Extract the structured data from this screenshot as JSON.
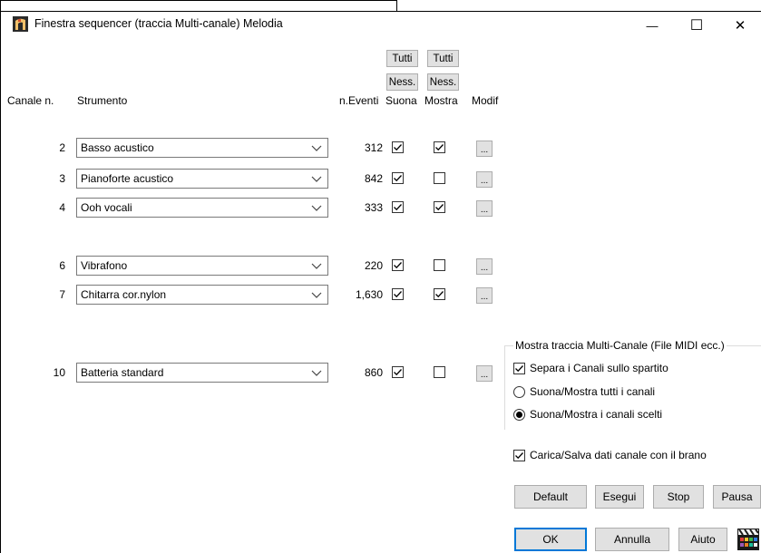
{
  "window": {
    "title": "Finestra sequencer (traccia Multi-canale) Melodia",
    "minimize_glyph": "—",
    "maximize_glyph": "☐",
    "close_glyph": "✕"
  },
  "header": {
    "channel_label": "Canale n.",
    "instrument_label": "Strumento",
    "events_label": "n.Eventi",
    "play_label": "Suona",
    "show_label": "Mostra",
    "edit_label": "Modif",
    "all_play_button": "Tutti",
    "all_show_button": "Tutti",
    "none_play_button": "Ness.",
    "none_show_button": "Ness."
  },
  "channels": [
    {
      "channel": "2",
      "instrument": "Basso acustico",
      "events": "312",
      "play": true,
      "show": true,
      "edit_label": "..."
    },
    {
      "channel": "3",
      "instrument": "Pianoforte acustico",
      "events": "842",
      "play": true,
      "show": false,
      "edit_label": "..."
    },
    {
      "channel": "4",
      "instrument": "Ooh vocali",
      "events": "333",
      "play": true,
      "show": true,
      "edit_label": "..."
    },
    {
      "channel": "6",
      "instrument": "Vibrafono",
      "events": "220",
      "play": true,
      "show": false,
      "edit_label": "..."
    },
    {
      "channel": "7",
      "instrument": "Chitarra cor.nylon",
      "events": "1,630",
      "play": true,
      "show": true,
      "edit_label": "..."
    },
    {
      "channel": "10",
      "instrument": "Batteria standard",
      "events": "860",
      "play": true,
      "show": false,
      "edit_label": "..."
    }
  ],
  "display_group": {
    "label": "Mostra traccia Multi-Canale (File MIDI ecc.)",
    "separate_channels": {
      "label": "Separa i Canali sullo spartito",
      "checked": true
    },
    "show_all": {
      "label": "Suona/Mostra tutti i canali",
      "selected": false
    },
    "show_selected": {
      "label": "Suona/Mostra i canali scelti",
      "selected": true
    }
  },
  "load_save": {
    "label": "Carica/Salva dati canale con il brano",
    "checked": true
  },
  "buttons": {
    "default": "Default",
    "play": "Esegui",
    "stop": "Stop",
    "pause": "Pausa",
    "ok": "OK",
    "cancel": "Annulla",
    "help": "Aiuto"
  },
  "icons": {
    "app": "band-app-icon",
    "dropdown": "chevron-down-icon",
    "corner": "clapperboard-icon"
  },
  "colors": {
    "focus_border": "#0078d7",
    "button_face": "#e1e1e1"
  }
}
